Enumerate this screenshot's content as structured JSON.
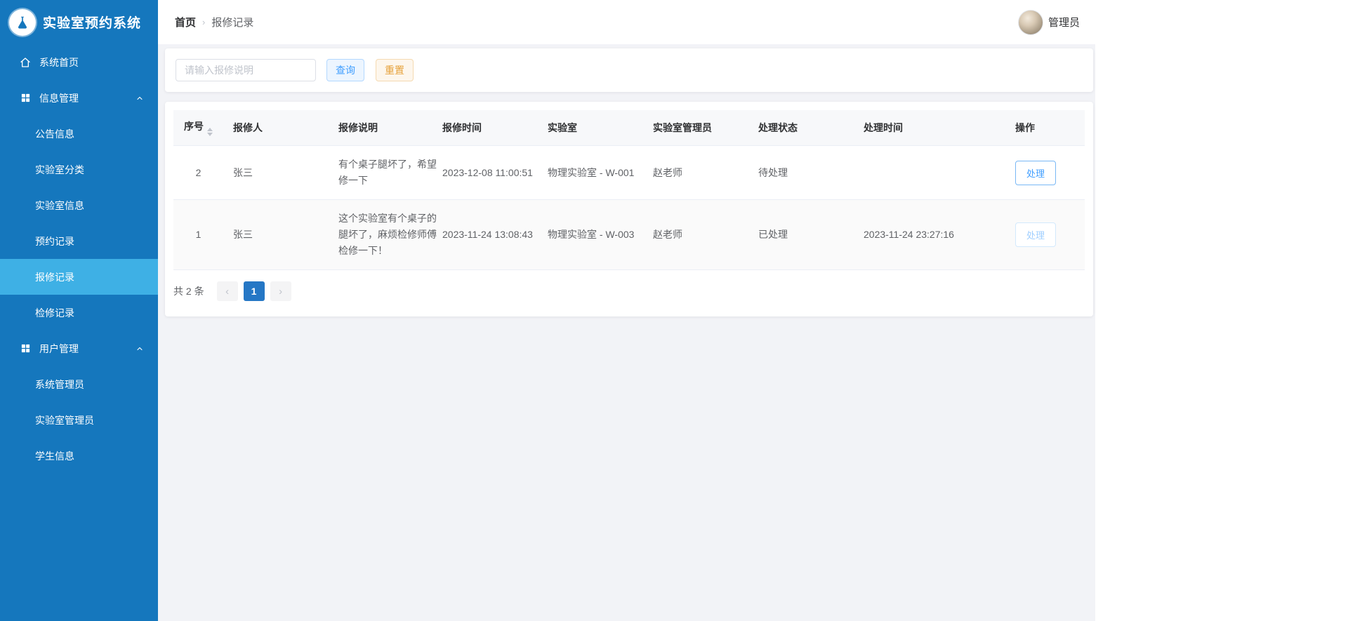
{
  "colors": {
    "sidebar": "#1577bd",
    "sidebar_active": "#3eb0e5",
    "primary": "#409eff",
    "reset_button": "#e6a23c",
    "pagination_active": "#2577c5"
  },
  "sidebar": {
    "title": "实验室预约系统",
    "logo_icon": "flask-icon",
    "items": {
      "home": {
        "label": "系统首页",
        "icon": "home-icon"
      },
      "info": {
        "label": "信息管理",
        "icon": "grid-icon",
        "expanded": true,
        "children": [
          "公告信息",
          "实验室分类",
          "实验室信息",
          "预约记录",
          "报修记录",
          "检修记录"
        ]
      },
      "user": {
        "label": "用户管理",
        "icon": "grid-icon",
        "expanded": true,
        "children": [
          "系统管理员",
          "实验室管理员",
          "学生信息"
        ]
      }
    },
    "active_item": "报修记录"
  },
  "header": {
    "breadcrumb": {
      "home": "首页",
      "separator": "›",
      "current": "报修记录"
    },
    "user_name": "管理员"
  },
  "search": {
    "placeholder": "请输入报修说明",
    "query_label": "查询",
    "reset_label": "重置"
  },
  "table": {
    "columns": [
      "序号",
      "报修人",
      "报修说明",
      "报修时间",
      "实验室",
      "实验室管理员",
      "处理状态",
      "处理时间",
      "操作"
    ],
    "rows": [
      {
        "seq": "2",
        "reporter": "张三",
        "description": "有个桌子腿坏了，希望修一下",
        "report_time": "2023-12-08 11:00:51",
        "lab": "物理实验室 - W-001",
        "manager": "赵老师",
        "status": "待处理",
        "handle_time": "",
        "action_label": "处理",
        "action_enabled": true
      },
      {
        "seq": "1",
        "reporter": "张三",
        "description": "这个实验室有个桌子的腿坏了，麻烦检修师傅检修一下！",
        "report_time": "2023-11-24 13:08:43",
        "lab": "物理实验室 - W-003",
        "manager": "赵老师",
        "status": "已处理",
        "handle_time": "2023-11-24 23:27:16",
        "action_label": "处理",
        "action_enabled": false
      }
    ]
  },
  "pagination": {
    "total_label": "共 2 条",
    "prev_icon": "chevron-left-icon",
    "current_page": "1",
    "next_icon": "chevron-right-icon"
  }
}
